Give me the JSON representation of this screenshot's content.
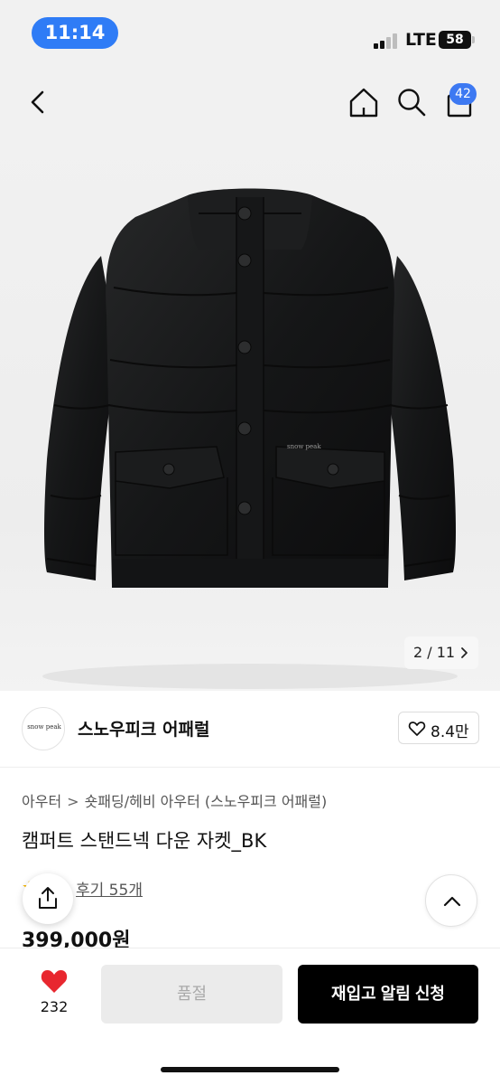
{
  "status_bar": {
    "time": "11:14",
    "network": "LTE",
    "battery": "58"
  },
  "nav": {
    "back_icon": "chevron-left-icon",
    "home_icon": "home-icon",
    "search_icon": "search-icon",
    "cart_icon": "shopping-bag-icon",
    "cart_count": "42"
  },
  "gallery": {
    "pager": "2 / 11",
    "jacket_logo_text": "snow peak"
  },
  "brand": {
    "name": "스노우피크 어패럴",
    "logo_text": "snow peak",
    "likes": "8.4만"
  },
  "breadcrumb": {
    "level1": "아우터",
    "separator": ">",
    "level2": "숏패딩/헤비 아우터 (스노우피크 어패럴)"
  },
  "product": {
    "title": "캠퍼트 스탠드넥 다운 자켓_BK",
    "reviews_label": "후기 55개",
    "price": "399,000원"
  },
  "actions": {
    "wish_count": "232",
    "soldout_label": "품절",
    "restock_label": "재입고 알림 신청"
  },
  "colors": {
    "accent_blue": "#2f7cf6",
    "heart_red": "#e8272f",
    "primary_button": "#000000",
    "disabled_button": "#ebebeb"
  }
}
